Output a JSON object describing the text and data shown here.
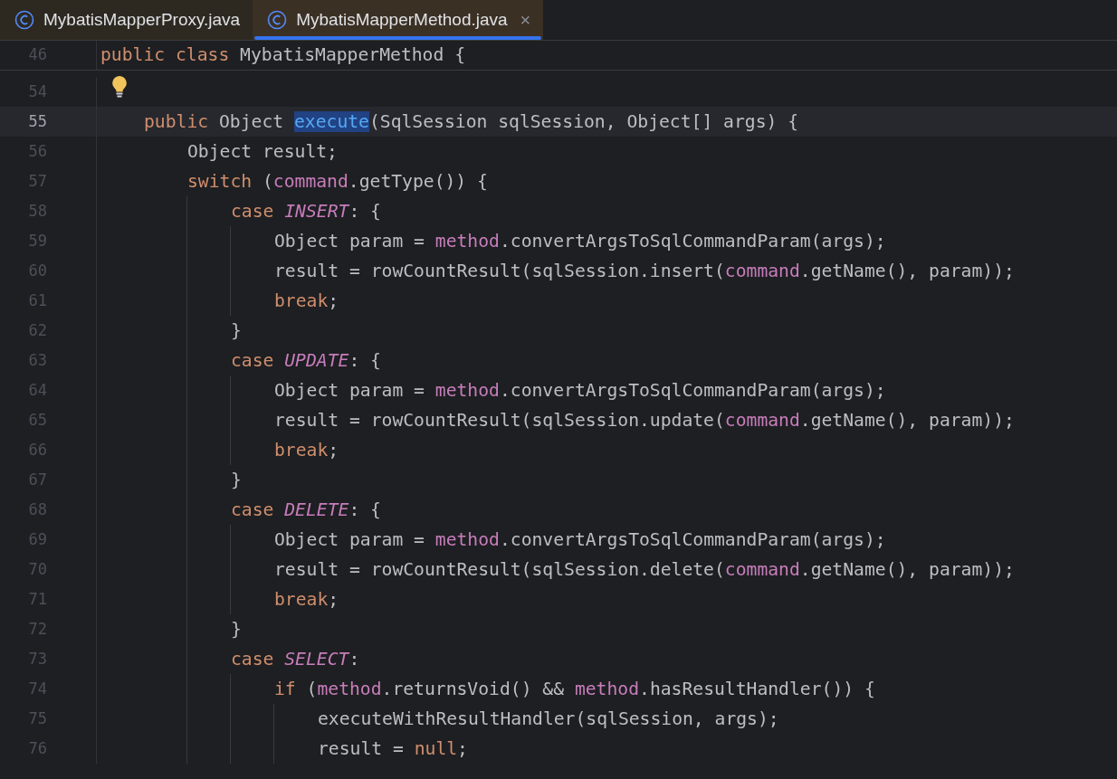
{
  "tabs": [
    {
      "label": "MybatisMapperProxy.java",
      "selected": false
    },
    {
      "label": "MybatisMapperMethod.java",
      "selected": true,
      "close": "×"
    }
  ],
  "sticky_line": {
    "number": "46",
    "tokens": [
      {
        "kind": "keyword",
        "text": "public class "
      },
      {
        "kind": "plain",
        "text": "MybatisMapperMethod {"
      }
    ]
  },
  "lines": [
    {
      "number": "54",
      "current": false,
      "bulb": true
    },
    {
      "number": "55",
      "current": true,
      "bulb": false,
      "tokens": [
        {
          "kind": "keyword",
          "text": "    public "
        },
        {
          "kind": "plain",
          "text": "Object "
        },
        {
          "kind": "usage",
          "text": "execute"
        },
        {
          "kind": "plain",
          "text": "(SqlSession sqlSession, Object[] args) {"
        }
      ]
    },
    {
      "number": "56",
      "current": false,
      "bulb": false,
      "tokens": [
        {
          "kind": "plain",
          "text": "        Object result;"
        }
      ]
    },
    {
      "number": "57",
      "current": false,
      "bulb": false,
      "tokens": [
        {
          "kind": "keyword",
          "text": "        switch "
        },
        {
          "kind": "plain",
          "text": "("
        },
        {
          "kind": "field",
          "text": "command"
        },
        {
          "kind": "plain",
          "text": ".getType()) {"
        }
      ]
    },
    {
      "number": "58",
      "current": false,
      "bulb": false,
      "tokens": [
        {
          "kind": "keyword",
          "text": "            case "
        },
        {
          "kind": "constant",
          "text": "INSERT"
        },
        {
          "kind": "plain",
          "text": ": {"
        }
      ]
    },
    {
      "number": "59",
      "current": false,
      "bulb": false,
      "tokens": [
        {
          "kind": "plain",
          "text": "                Object param = "
        },
        {
          "kind": "field",
          "text": "method"
        },
        {
          "kind": "plain",
          "text": ".convertArgsToSqlCommandParam(args);"
        }
      ]
    },
    {
      "number": "60",
      "current": false,
      "bulb": false,
      "tokens": [
        {
          "kind": "plain",
          "text": "                result = rowCountResult(sqlSession.insert("
        },
        {
          "kind": "field",
          "text": "command"
        },
        {
          "kind": "plain",
          "text": ".getName(), param));"
        }
      ]
    },
    {
      "number": "61",
      "current": false,
      "bulb": false,
      "tokens": [
        {
          "kind": "keyword",
          "text": "                break"
        },
        {
          "kind": "plain",
          "text": ";"
        }
      ]
    },
    {
      "number": "62",
      "current": false,
      "bulb": false,
      "tokens": [
        {
          "kind": "plain",
          "text": "            }"
        }
      ]
    },
    {
      "number": "63",
      "current": false,
      "bulb": false,
      "tokens": [
        {
          "kind": "keyword",
          "text": "            case "
        },
        {
          "kind": "constant",
          "text": "UPDATE"
        },
        {
          "kind": "plain",
          "text": ": {"
        }
      ]
    },
    {
      "number": "64",
      "current": false,
      "bulb": false,
      "tokens": [
        {
          "kind": "plain",
          "text": "                Object param = "
        },
        {
          "kind": "field",
          "text": "method"
        },
        {
          "kind": "plain",
          "text": ".convertArgsToSqlCommandParam(args);"
        }
      ]
    },
    {
      "number": "65",
      "current": false,
      "bulb": false,
      "tokens": [
        {
          "kind": "plain",
          "text": "                result = rowCountResult(sqlSession.update("
        },
        {
          "kind": "field",
          "text": "command"
        },
        {
          "kind": "plain",
          "text": ".getName(), param));"
        }
      ]
    },
    {
      "number": "66",
      "current": false,
      "bulb": false,
      "tokens": [
        {
          "kind": "keyword",
          "text": "                break"
        },
        {
          "kind": "plain",
          "text": ";"
        }
      ]
    },
    {
      "number": "67",
      "current": false,
      "bulb": false,
      "tokens": [
        {
          "kind": "plain",
          "text": "            }"
        }
      ]
    },
    {
      "number": "68",
      "current": false,
      "bulb": false,
      "tokens": [
        {
          "kind": "keyword",
          "text": "            case "
        },
        {
          "kind": "constant",
          "text": "DELETE"
        },
        {
          "kind": "plain",
          "text": ": {"
        }
      ]
    },
    {
      "number": "69",
      "current": false,
      "bulb": false,
      "tokens": [
        {
          "kind": "plain",
          "text": "                Object param = "
        },
        {
          "kind": "field",
          "text": "method"
        },
        {
          "kind": "plain",
          "text": ".convertArgsToSqlCommandParam(args);"
        }
      ]
    },
    {
      "number": "70",
      "current": false,
      "bulb": false,
      "tokens": [
        {
          "kind": "plain",
          "text": "                result = rowCountResult(sqlSession.delete("
        },
        {
          "kind": "field",
          "text": "command"
        },
        {
          "kind": "plain",
          "text": ".getName(), param));"
        }
      ]
    },
    {
      "number": "71",
      "current": false,
      "bulb": false,
      "tokens": [
        {
          "kind": "keyword",
          "text": "                break"
        },
        {
          "kind": "plain",
          "text": ";"
        }
      ]
    },
    {
      "number": "72",
      "current": false,
      "bulb": false,
      "tokens": [
        {
          "kind": "plain",
          "text": "            }"
        }
      ]
    },
    {
      "number": "73",
      "current": false,
      "bulb": false,
      "tokens": [
        {
          "kind": "keyword",
          "text": "            case "
        },
        {
          "kind": "constant",
          "text": "SELECT"
        },
        {
          "kind": "plain",
          "text": ":"
        }
      ]
    },
    {
      "number": "74",
      "current": false,
      "bulb": false,
      "tokens": [
        {
          "kind": "keyword",
          "text": "                if "
        },
        {
          "kind": "plain",
          "text": "("
        },
        {
          "kind": "field",
          "text": "method"
        },
        {
          "kind": "plain",
          "text": ".returnsVoid() && "
        },
        {
          "kind": "field",
          "text": "method"
        },
        {
          "kind": "plain",
          "text": ".hasResultHandler()) {"
        }
      ]
    },
    {
      "number": "75",
      "current": false,
      "bulb": false,
      "tokens": [
        {
          "kind": "plain",
          "text": "                    executeWithResultHandler(sqlSession, args);"
        }
      ]
    },
    {
      "number": "76",
      "current": false,
      "bulb": false,
      "tokens": [
        {
          "kind": "plain",
          "text": "                    result = "
        },
        {
          "kind": "keyword",
          "text": "null"
        },
        {
          "kind": "plain",
          "text": ";"
        }
      ]
    }
  ]
}
